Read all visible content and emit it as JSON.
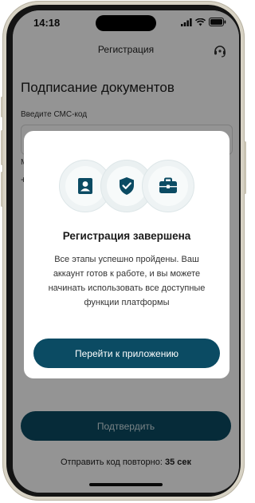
{
  "status_bar": {
    "time": "14:18"
  },
  "header": {
    "title": "Регистрация",
    "support_icon": "support-icon"
  },
  "form": {
    "heading": "Подписание документов",
    "sms_label": "Введите СМС-код",
    "sms_value": "",
    "partial_label": "М",
    "partial_plus": "+"
  },
  "confirm_button": {
    "label": "Подтвердить"
  },
  "resend": {
    "text": "Отправить код повторно:",
    "timer": "35 сек"
  },
  "modal": {
    "icons": [
      "user-card-icon",
      "shield-check-icon",
      "briefcase-icon"
    ],
    "title": "Регистрация завершена",
    "description": "Все этапы успешно пройдены. Ваш аккаунт готов к работе, и вы можете начинать использовать все доступные функции платформы",
    "button_label": "Перейти к приложению"
  },
  "colors": {
    "accent": "#0b4b63",
    "icon": "#0b4b63",
    "overlay": "rgba(0,0,0,0.42)"
  }
}
